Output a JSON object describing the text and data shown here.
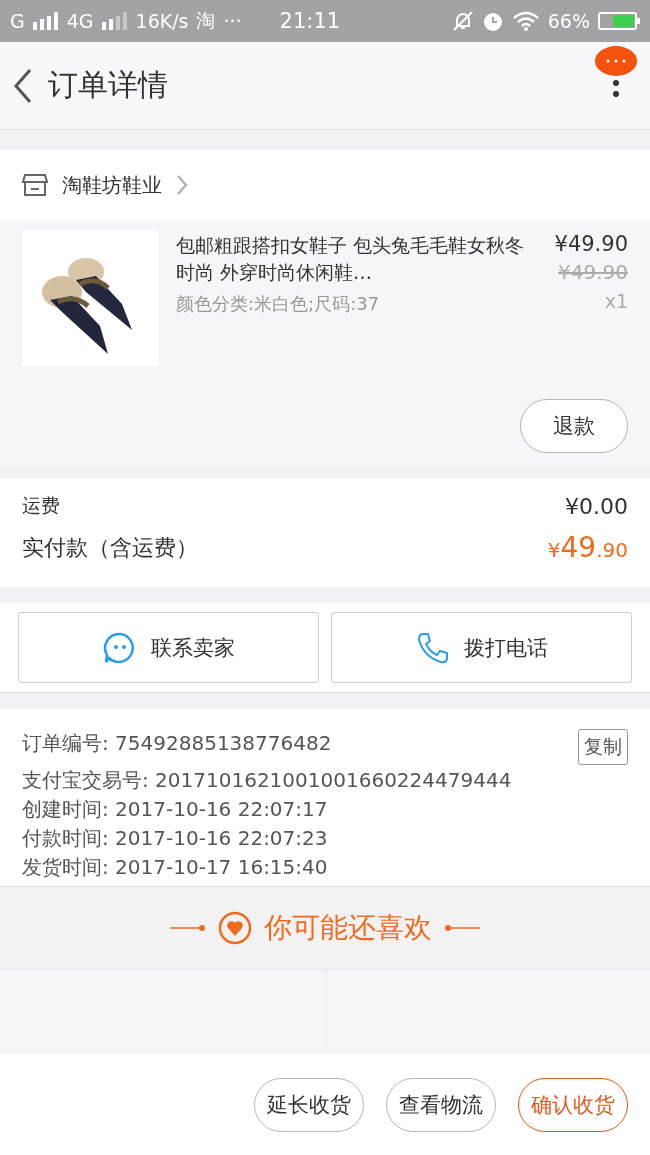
{
  "status_bar": {
    "carrier_1": "G",
    "carrier_2": "4G",
    "speed": "16K/s",
    "app": "淘",
    "more": "···",
    "time": "21:11",
    "battery": "66%"
  },
  "header": {
    "title": "订单详情"
  },
  "shop": {
    "name": "淘鞋坊鞋业"
  },
  "item": {
    "title": "包邮粗跟搭扣女鞋子 包头兔毛毛鞋女秋冬时尚 外穿时尚休闲鞋…",
    "sku": "颜色分类:米白色;尺码:37",
    "price": "¥49.90",
    "original_price": "¥49.90",
    "quantity": "x1",
    "refund_button": "退款"
  },
  "fees": {
    "shipping_label": "运费",
    "shipping": "¥0.00",
    "paid_label": "实付款（含运费）",
    "paid_symbol": "¥",
    "paid_integer": "49",
    "paid_decimal": ".90"
  },
  "contact_buttons": [
    {
      "kind": "chat",
      "label": "联系卖家"
    },
    {
      "kind": "phone",
      "label": "拨打电话"
    }
  ],
  "order_info": {
    "copy_button": "复制",
    "lines": [
      "订单编号: 75492885138776482",
      "支付宝交易号: 2017101621001001660224479444",
      "创建时间: 2017-10-16 22:07:17",
      "付款时间: 2017-10-16 22:07:23",
      "发货时间: 2017-10-17 16:15:40"
    ]
  },
  "recommend": {
    "title": "你可能还喜欢"
  },
  "bottom_actions": [
    {
      "label": "延长收货",
      "primary": false
    },
    {
      "label": "查看物流",
      "primary": false
    },
    {
      "label": "确认收货",
      "primary": true
    }
  ]
}
